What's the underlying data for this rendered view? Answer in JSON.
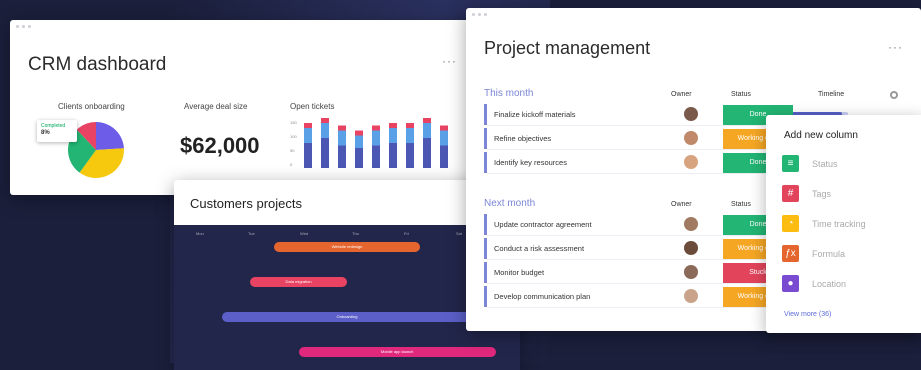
{
  "crm": {
    "title": "CRM dashboard",
    "more": "···",
    "widgets": {
      "clients_onboarding": "Clients onboarding",
      "average_deal_size": "Average deal size",
      "open_tickets": "Open tickets"
    },
    "pie_badge_sub": "Completed",
    "pie_badge_value": "8%",
    "deal_value": "$62,000",
    "pie_slices": [
      {
        "share": 0.24,
        "color": "#6c5ce7"
      },
      {
        "share": 0.36,
        "color": "#f6c90e"
      },
      {
        "share": 0.28,
        "color": "#22b573"
      },
      {
        "share": 0.12,
        "color": "#e84363"
      }
    ],
    "ticket_axis": [
      "150",
      "100",
      "50",
      "0"
    ],
    "ticket_bars": [
      [
        0.5,
        0.3,
        0.1
      ],
      [
        0.6,
        0.3,
        0.1
      ],
      [
        0.45,
        0.3,
        0.1
      ],
      [
        0.4,
        0.25,
        0.1
      ],
      [
        0.45,
        0.3,
        0.1
      ],
      [
        0.5,
        0.3,
        0.1
      ],
      [
        0.5,
        0.3,
        0.1
      ],
      [
        0.6,
        0.3,
        0.1
      ],
      [
        0.45,
        0.3,
        0.1
      ]
    ],
    "ticket_colors": [
      "#4c57b3",
      "#5aa0e6",
      "#e84363"
    ]
  },
  "customers": {
    "title": "Customers projects",
    "days": [
      "Mon",
      "Tue",
      "Wed",
      "Thu",
      "Fri",
      "Sat"
    ],
    "bars": [
      {
        "label": "Website redesign",
        "color": "#e5652f",
        "start": 0.29,
        "end": 0.71,
        "row": 0
      },
      {
        "label": "Data migration",
        "color": "#e84363",
        "start": 0.22,
        "end": 0.5,
        "row": 1
      },
      {
        "label": "Onboarding",
        "color": "#5b5fc7",
        "start": 0.14,
        "end": 0.86,
        "row": 2
      },
      {
        "label": "Mobile app launch",
        "color": "#e0287d",
        "start": 0.36,
        "end": 0.93,
        "row": 3
      }
    ]
  },
  "pm": {
    "title": "Project management",
    "more": "···",
    "columns": {
      "owner": "Owner",
      "status": "Status",
      "timeline": "Timeline"
    },
    "groups": [
      {
        "label": "This month",
        "rows": [
          {
            "name": "Finalize kickoff materials",
            "status": "Done",
            "status_color": "#22b573",
            "avatar_color": "#7a5a4a"
          },
          {
            "name": "Refine objectives",
            "status": "Working on it",
            "status_color": "#f5a623",
            "avatar_color": "#c08a6a"
          },
          {
            "name": "Identify key resources",
            "status": "Done",
            "status_color": "#22b573",
            "avatar_color": "#d8a47f"
          }
        ]
      },
      {
        "label": "Next month",
        "rows": [
          {
            "name": "Update contractor agreement",
            "status": "Done",
            "status_color": "#22b573",
            "avatar_color": "#a07a62"
          },
          {
            "name": "Conduct a risk assessment",
            "status": "Working on it",
            "status_color": "#f5a623",
            "avatar_color": "#6b4c3b"
          },
          {
            "name": "Monitor budget",
            "status": "Stuck",
            "status_color": "#e2445c",
            "avatar_color": "#8a6a58"
          },
          {
            "name": "Develop communication plan",
            "status": "Working on it",
            "status_color": "#f5a623",
            "avatar_color": "#c9a48b"
          }
        ]
      }
    ],
    "timeline_progress": 0.9
  },
  "popup": {
    "title": "Add new column",
    "options": [
      {
        "label": "Status",
        "icon": "≡",
        "color": "#22b573",
        "icon_name": "status-icon"
      },
      {
        "label": "Tags",
        "icon": "#",
        "color": "#e2445c",
        "icon_name": "tag-icon"
      },
      {
        "label": "Time tracking",
        "icon": "◔",
        "color": "#fdbc11",
        "icon_name": "clock-icon"
      },
      {
        "label": "Formula",
        "icon": "ƒx",
        "color": "#e5652f",
        "icon_name": "formula-icon"
      },
      {
        "label": "Location",
        "icon": "●",
        "color": "#784bd1",
        "icon_name": "location-pin-icon"
      }
    ],
    "view_more": "View more (36)"
  }
}
